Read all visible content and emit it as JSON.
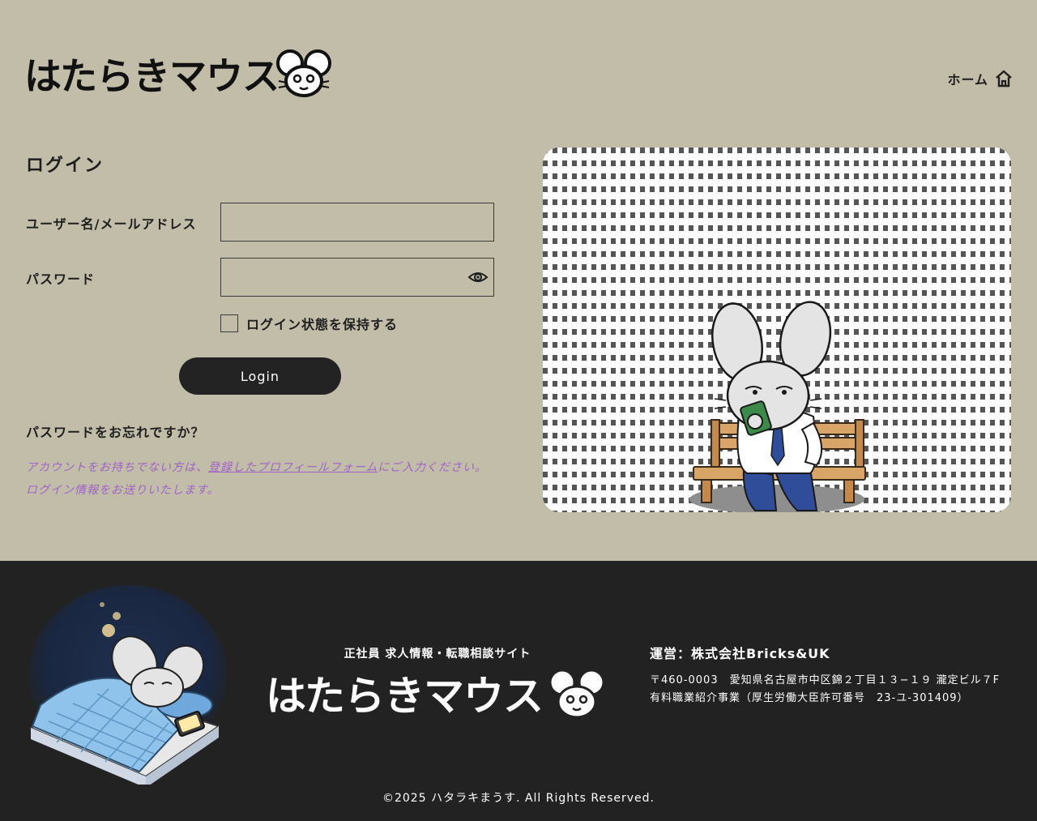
{
  "header": {
    "logo_text": "はたらきマウス",
    "nav_home_label": "ホーム"
  },
  "login": {
    "title": "ログイン",
    "username_label": "ユーザー名/メールアドレス",
    "username_value": "",
    "password_label": "パスワード",
    "password_value": "",
    "remember_label": "ログイン状態を保持する",
    "remember_checked": false,
    "submit_label": "Login",
    "forgot_label": "パスワードをお忘れですか？",
    "notice_prefix": "アカウントをお持ちでない方は、",
    "notice_link": "登録したプロフィールフォーム",
    "notice_suffix": "にご入力ください。",
    "notice_line2": "ログイン情報をお送りいたします。"
  },
  "footer": {
    "tagline": "正社員 求人情報・転職相談サイト",
    "logo_text": "はたらきマウス",
    "operator": "運営：株式会社Bricks&UK",
    "address_line1": "〒460-0003　愛知県名古屋市中区錦２丁目１３−１９ 瀧定ビル７F",
    "address_line2": "有料職業紹介事業（厚生労働大臣許可番号　23-ユ-301409）",
    "copyright": "©2025 ハタラキまうす. All Rights Reserved."
  },
  "colors": {
    "page_bg": "#c1bda9",
    "footer_bg": "#222222",
    "button_bg": "#232323",
    "notice_text": "#a063c7"
  },
  "icons": {
    "nav_home": "home-icon",
    "password_toggle": "eye-icon",
    "logo_mascot": "mouse-face-icon"
  }
}
